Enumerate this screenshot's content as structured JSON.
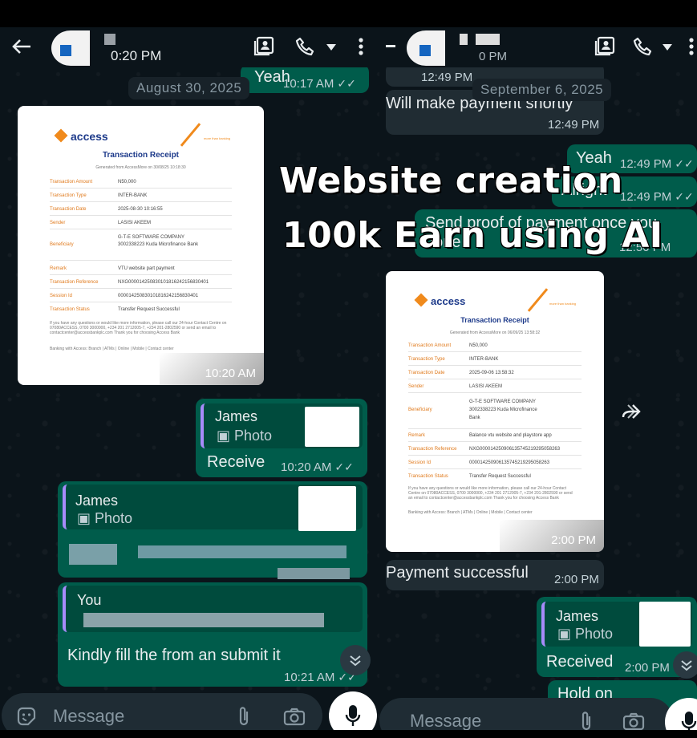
{
  "overlay": {
    "line1": "Website creation",
    "line2": "100k Earn using AI"
  },
  "left": {
    "header": {
      "time": "0:20 PM"
    },
    "date_chip": "August 30, 2025",
    "top_partial": {
      "text": "Yeah",
      "time": "10:17 AM"
    },
    "receipt": {
      "brand": "access",
      "tag": "more than banking",
      "title": "Transaction Receipt",
      "generated": "Generated from AccessMore on 30/08/25 10:18:30",
      "rows": [
        {
          "label": "Transaction Amount",
          "value": "N50,000"
        },
        {
          "label": "Transaction Type",
          "value": "INTER-BANK"
        },
        {
          "label": "Transaction Date",
          "value": "2025-08-30 10:16:55"
        },
        {
          "label": "Sender",
          "value": "LASISI AKEEM"
        },
        {
          "label": "Beneficiary",
          "value": "G-T-E SOFTWARE COMPANY 3002338223 Kuda Microfinance Bank"
        },
        {
          "label": "Remark",
          "value": "VTU website part payment"
        },
        {
          "label": "Transaction Reference",
          "value": "NXG000014250830101816242156830401"
        },
        {
          "label": "Session Id",
          "value": "000014250830101816242156830401"
        },
        {
          "label": "Transaction Status",
          "value": "Transfer Request Successful"
        }
      ],
      "footer": "If you have any questions or would like more information, please call our 24-hour Contact Centre on 07080ACCESS, 0700 3000000, +234 201 2712005-7, +234 201-2802590 or send an email to contactcenter@accessbankplc.com Thank you for choosing Access Bank",
      "footer2": "Banking with Access: Branch | ATMs | Online | Mobile | Contact center",
      "time": "10:20 AM"
    },
    "reply1": {
      "name": "James",
      "sub": "Photo",
      "text": "Receive",
      "time": "10:20 AM"
    },
    "reply2": {
      "name": "James",
      "sub": "Photo"
    },
    "reply3": {
      "name": "You",
      "text": "Kindly fill the from an submit it",
      "time": "10:21 AM"
    },
    "input": {
      "placeholder": "Message"
    }
  },
  "right": {
    "header": {
      "time": "0 PM"
    },
    "date_chip": "September 6, 2025",
    "top_time": "12:49 PM",
    "msg1": {
      "text": "Will make payment shortly",
      "time": "12:49 PM"
    },
    "msg2": {
      "text": "Yeah",
      "time": "12:49 PM"
    },
    "msg3": {
      "text": "Alright",
      "time": "12:49 PM"
    },
    "msg4": {
      "line1": "Send proof of payment once you",
      "line2": "done",
      "time": "12:50 PM"
    },
    "receipt": {
      "brand": "access",
      "tag": "more than banking",
      "title": "Transaction Receipt",
      "generated": "Generated from AccessMore on 06/09/25 13:58:32",
      "rows": [
        {
          "label": "Transaction Amount",
          "value": "N50,000"
        },
        {
          "label": "Transaction Type",
          "value": "INTER-BANK"
        },
        {
          "label": "Transaction Date",
          "value": "2025-09-06 13:58:32"
        },
        {
          "label": "Sender",
          "value": "LASISI AKEEM"
        },
        {
          "label": "Beneficiary",
          "value": "G-T-E SOFTWARE COMPANY 3002338223 Kuda Microfinance Bank"
        },
        {
          "label": "Remark",
          "value": "Balance vtu website and playstore app"
        },
        {
          "label": "Transaction Reference",
          "value": "NXG000014250906135745219295058263"
        },
        {
          "label": "Session Id",
          "value": "000014250906135745219295058263"
        },
        {
          "label": "Transaction Status",
          "value": "Transfer Request Successful"
        }
      ],
      "footer": "If you have any questions or would like more information, please call our 24-hour Contact Centre on 07080ACCESS, 0700 3000000, +234 201 2712005-7, +234 201-2802590 or send an email to contactcenter@accessbankplc.com Thank you for choosing Access Bank",
      "footer2": "Banking with Access: Branch | ATMs | Online | Mobile | Contact center",
      "time": "2:00 PM"
    },
    "msg5": {
      "text": "Payment successful",
      "time": "2:00 PM"
    },
    "reply1": {
      "name": "James",
      "sub": "Photo",
      "text": "Received",
      "time": "2:00 PM"
    },
    "msg6": {
      "text": "Hold on"
    },
    "input": {
      "placeholder": "Message"
    }
  }
}
